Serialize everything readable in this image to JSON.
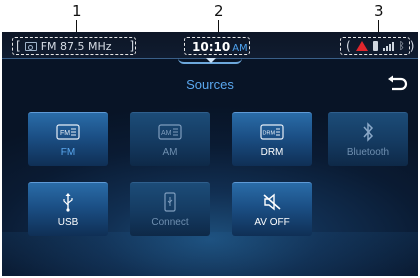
{
  "callouts": [
    "1",
    "2",
    "3"
  ],
  "status": {
    "source_text": "FM 87.5 MHz",
    "time": "10:10",
    "ampm": "AM"
  },
  "title": "Sources",
  "sources": [
    {
      "label": "FM",
      "state": "selected",
      "icon": "radio-fm-icon",
      "glyph": "FM"
    },
    {
      "label": "AM",
      "state": "disabled",
      "icon": "radio-am-icon",
      "glyph": "AM"
    },
    {
      "label": "DRM",
      "state": "enabled",
      "icon": "radio-drm-icon",
      "glyph": "DRM"
    },
    {
      "label": "Bluetooth",
      "state": "disabled",
      "icon": "bluetooth-icon"
    },
    {
      "label": "USB",
      "state": "enabled",
      "icon": "usb-icon"
    },
    {
      "label": "Connect",
      "state": "disabled",
      "icon": "phone-connect-icon"
    },
    {
      "label": "AV OFF",
      "state": "enabled",
      "icon": "speaker-mute-icon"
    }
  ],
  "colors": {
    "accent": "#5aa7ee",
    "warning": "#e0262c",
    "background": "#0a1b33"
  }
}
